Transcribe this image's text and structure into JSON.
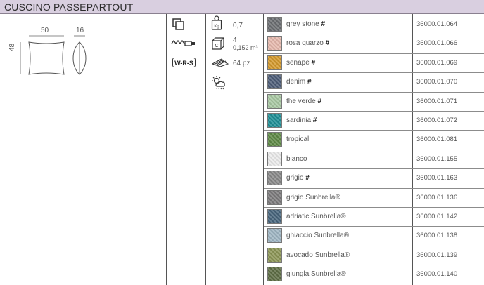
{
  "product": {
    "title": "CUSCINO PASSEPARTOUT"
  },
  "dimensions": {
    "width": "50",
    "depth": "16",
    "height": "48"
  },
  "specs": {
    "weight": "0,7",
    "pack_count": "4",
    "volume": "0,152 m³",
    "pallet": "64 pz",
    "certification": "W-R-S"
  },
  "colors": [
    {
      "name": "grey stone",
      "mark": "#",
      "code": "36000.01.064",
      "swatch": "#6b6e72"
    },
    {
      "name": "rosa quarzo",
      "mark": "#",
      "code": "36000.01.066",
      "swatch": "#e7b9ad"
    },
    {
      "name": "senape",
      "mark": "#",
      "code": "36000.01.069",
      "swatch": "#d59a2c"
    },
    {
      "name": "denim",
      "mark": "#",
      "code": "36000.01.070",
      "swatch": "#4d5d78"
    },
    {
      "name": "the verde",
      "mark": "#",
      "code": "36000.01.071",
      "swatch": "#a9c9a3"
    },
    {
      "name": "sardinia",
      "mark": "#",
      "code": "36000.01.072",
      "swatch": "#1e8f96"
    },
    {
      "name": "tropical",
      "mark": "",
      "code": "36000.01.081",
      "swatch": "#5e8a45"
    },
    {
      "name": "bianco",
      "mark": "",
      "code": "36000.01.155",
      "swatch": "#ececec"
    },
    {
      "name": "grigio",
      "mark": "#",
      "code": "36000.01.163",
      "swatch": "#8a8a8a"
    },
    {
      "name": "grigio Sunbrella®",
      "mark": "",
      "code": "36000.01.136",
      "swatch": "#7d7b7d"
    },
    {
      "name": "adriatic Sunbrella®",
      "mark": "",
      "code": "36000.01.142",
      "swatch": "#47657d"
    },
    {
      "name": "ghiaccio Sunbrella®",
      "mark": "",
      "code": "36000.01.138",
      "swatch": "#9fb6c4"
    },
    {
      "name": "avocado Sunbrella®",
      "mark": "",
      "code": "36000.01.139",
      "swatch": "#8c9656"
    },
    {
      "name": "giungla Sunbrella®",
      "mark": "",
      "code": "36000.01.140",
      "swatch": "#5e6e45"
    }
  ]
}
